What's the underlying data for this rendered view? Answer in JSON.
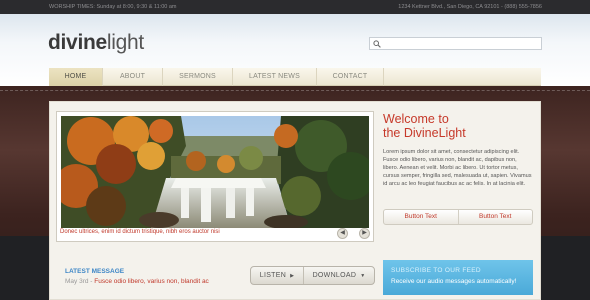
{
  "topbar": {
    "worship_times": "WORSHIP TIMES: Sunday at 8:00, 9:30 & 11:00 am",
    "address": "1234 Kettner Blvd., San Diego, CA 92101 - (888) 555-7856"
  },
  "header": {
    "logo_bold": "divine",
    "logo_light": "light",
    "search_placeholder": ""
  },
  "nav": {
    "items": [
      {
        "label": "HOME"
      },
      {
        "label": "ABOUT"
      },
      {
        "label": "SERMONS"
      },
      {
        "label": "LATEST NEWS"
      },
      {
        "label": "CONTACT"
      }
    ]
  },
  "slider": {
    "caption": "Donec ultrices, enim id dictum tristique, nibh eros auctor nisi",
    "prev_icon": "chevron-left-icon",
    "next_icon": "chevron-right-icon"
  },
  "welcome": {
    "title_line1": "Welcome to",
    "title_line2": "the DivineLight",
    "body": "Lorem ipsum dolor sit amet, consectetur adipiscing elit. Fusce odio libero, varius non, blandit ac, dapibus non, libero. Aenean et velit. Morbi ac libero. Ut tortor metus, cursus semper, fringilla sed, malesuada ut, sapien. Vivamus id arcu ac leo feugiat faucibus ac ac felis. In at lacinia elit.",
    "button1": "Button Text",
    "button2": "Button Text"
  },
  "latest": {
    "title": "LATEST MESSAGE",
    "date": "May 3rd - ",
    "message": "Fusce odio libero, varius non, blandit ac",
    "listen_label": "LISTEN",
    "download_label": "DOWNLOAD"
  },
  "subscribe": {
    "title": "SUBSCRIBE TO OUR FEED",
    "subtitle": "Receive our audio messages automatically!"
  },
  "colors": {
    "accent_red": "#c6392a",
    "accent_blue": "#3d86c6",
    "subscribe_blue": "#5bb7e2",
    "leather": "#4a2e29"
  }
}
